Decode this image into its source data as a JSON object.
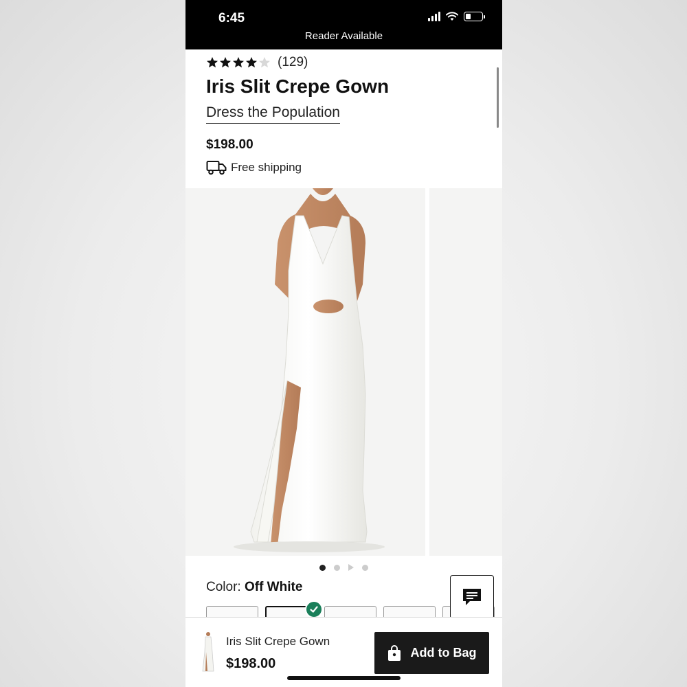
{
  "status_bar": {
    "time": "6:45",
    "reader_text": "Reader Available",
    "battery_level": 0.3
  },
  "product": {
    "rating": 4,
    "rating_max": 5,
    "rating_count": "(129)",
    "title": "Iris Slit Crepe Gown",
    "brand": "Dress the Population",
    "price": "$198.00",
    "shipping": "Free shipping"
  },
  "carousel": {
    "slide_count": 4,
    "active_index": 0
  },
  "color": {
    "label": "Color:",
    "value": "Off White",
    "swatch_count": 5,
    "selected_index": 1
  },
  "sticky_bar": {
    "title": "Iris Slit Crepe Gown",
    "price": "$198.00",
    "add_label": "Add to Bag"
  },
  "icons": {
    "truck": "truck-icon",
    "chat": "chat-icon",
    "bag": "shopping-bag-icon",
    "check": "checkmark-icon"
  },
  "colors": {
    "accent_check": "#1a7f5a",
    "button_dark": "#1a1a1a"
  }
}
